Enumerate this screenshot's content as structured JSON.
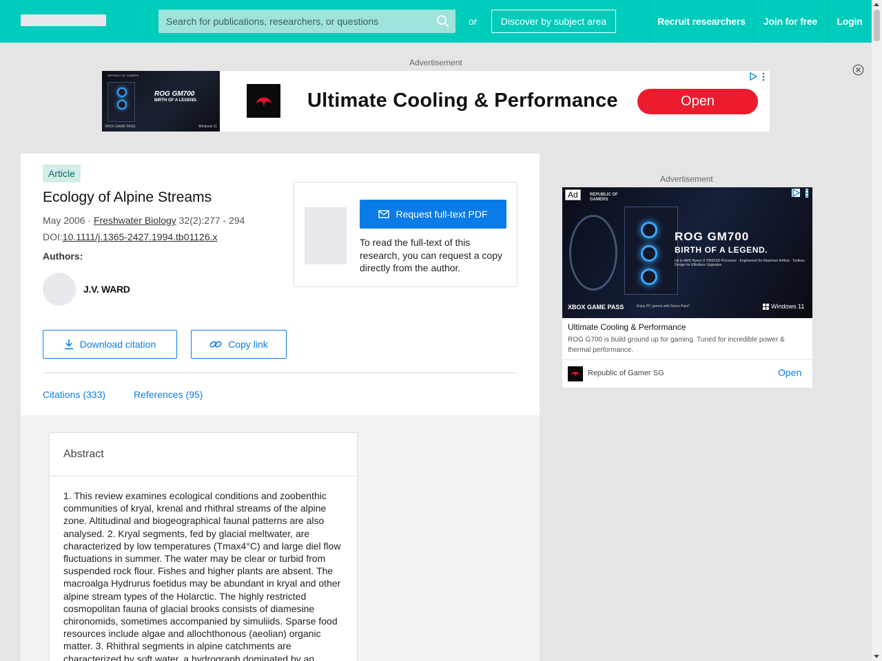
{
  "header": {
    "search_placeholder": "Search for publications, researchers, or questions",
    "or_text": "or",
    "discover_label": "Discover by subject area",
    "nav": {
      "recruit": "Recruit researchers",
      "join": "Join for free",
      "login": "Login"
    },
    "accent_color": "#00ccbb"
  },
  "ads": {
    "label": "Advertisement",
    "top_banner": {
      "headline": "Ultimate Cooling & Performance",
      "open_label": "Open",
      "image_title": "ROG GM700",
      "image_subtitle": "BIRTH OF A LEGEND.",
      "image_brand": "REPUBLIC OF GAMERS",
      "image_footer_left": "XBOX GAME PASS",
      "image_footer_right": "Windows 11"
    },
    "side": {
      "ad_tag": "Ad",
      "brand_small": "REPUBLIC OF GAMERS",
      "headline_image": "ROG GM700",
      "subheadline_image": "BIRTH OF A LEGEND.",
      "specs_image": "Up to AMD Ryzen 9 7950X3D Processor · Engineered for Maximum Airflow · Toolless Design for Effortless Upgrades",
      "xbox": "XBOX GAME PASS",
      "xbox_sub": "Enjoy PC games with Game Pass*",
      "windows": "Windows 11",
      "title": "Ultimate Cooling & Performance",
      "description": "ROG G700 is build ground up for gaming. Tuned for incredible power & thermal performance.",
      "advertiser": "Republic of Gamer SG",
      "open_label": "Open"
    }
  },
  "publication": {
    "type": "Article",
    "title": "Ecology of Alpine Streams",
    "date": "May 2006 · ",
    "journal": "Freshwater Biology",
    "pages": " 32(2):277 - 294",
    "doi_label": "DOI:",
    "doi": "10.1111/j.1365-2427.1994.tb01126.x",
    "authors_label": "Authors:",
    "authors": [
      {
        "name": "J.V. WARD"
      }
    ],
    "request_label": "Request full-text PDF",
    "request_text": "To read the full-text of this research, you can request a copy directly from the author.",
    "download_label": "Download citation",
    "copy_label": "Copy link",
    "tabs": {
      "citations": "Citations (333)",
      "references": "References (95)"
    },
    "abstract_title": "Abstract",
    "abstract": "1. This review examines ecological conditions and zoobenthic communities of kryal, krenal and rhithral streams of the alpine zone. Altitudinal and biogeographical faunal patterns are also analysed. 2. Kryal segments, fed by glacial meltwater, are characterized by low temperatures (Tmax4°C) and large diel flow fluctuations in summer. The water may be clear or turbid from suspended rock flour. Fishes and higher plants are absent. The macroalga Hydrurus foetidus may be abundant in kryal and other alpine stream types of the Holarctic. The highly restricted cosmopolitan fauna of glacial brooks consists of diamesine chironomids, sometimes accompanied by simuliids. Sparse food resources include algae and allochthonous (aeolian) organic matter. 3. Rhithral segments in alpine catchments are characterized by soft water, a hydrograph dominated by an"
  }
}
